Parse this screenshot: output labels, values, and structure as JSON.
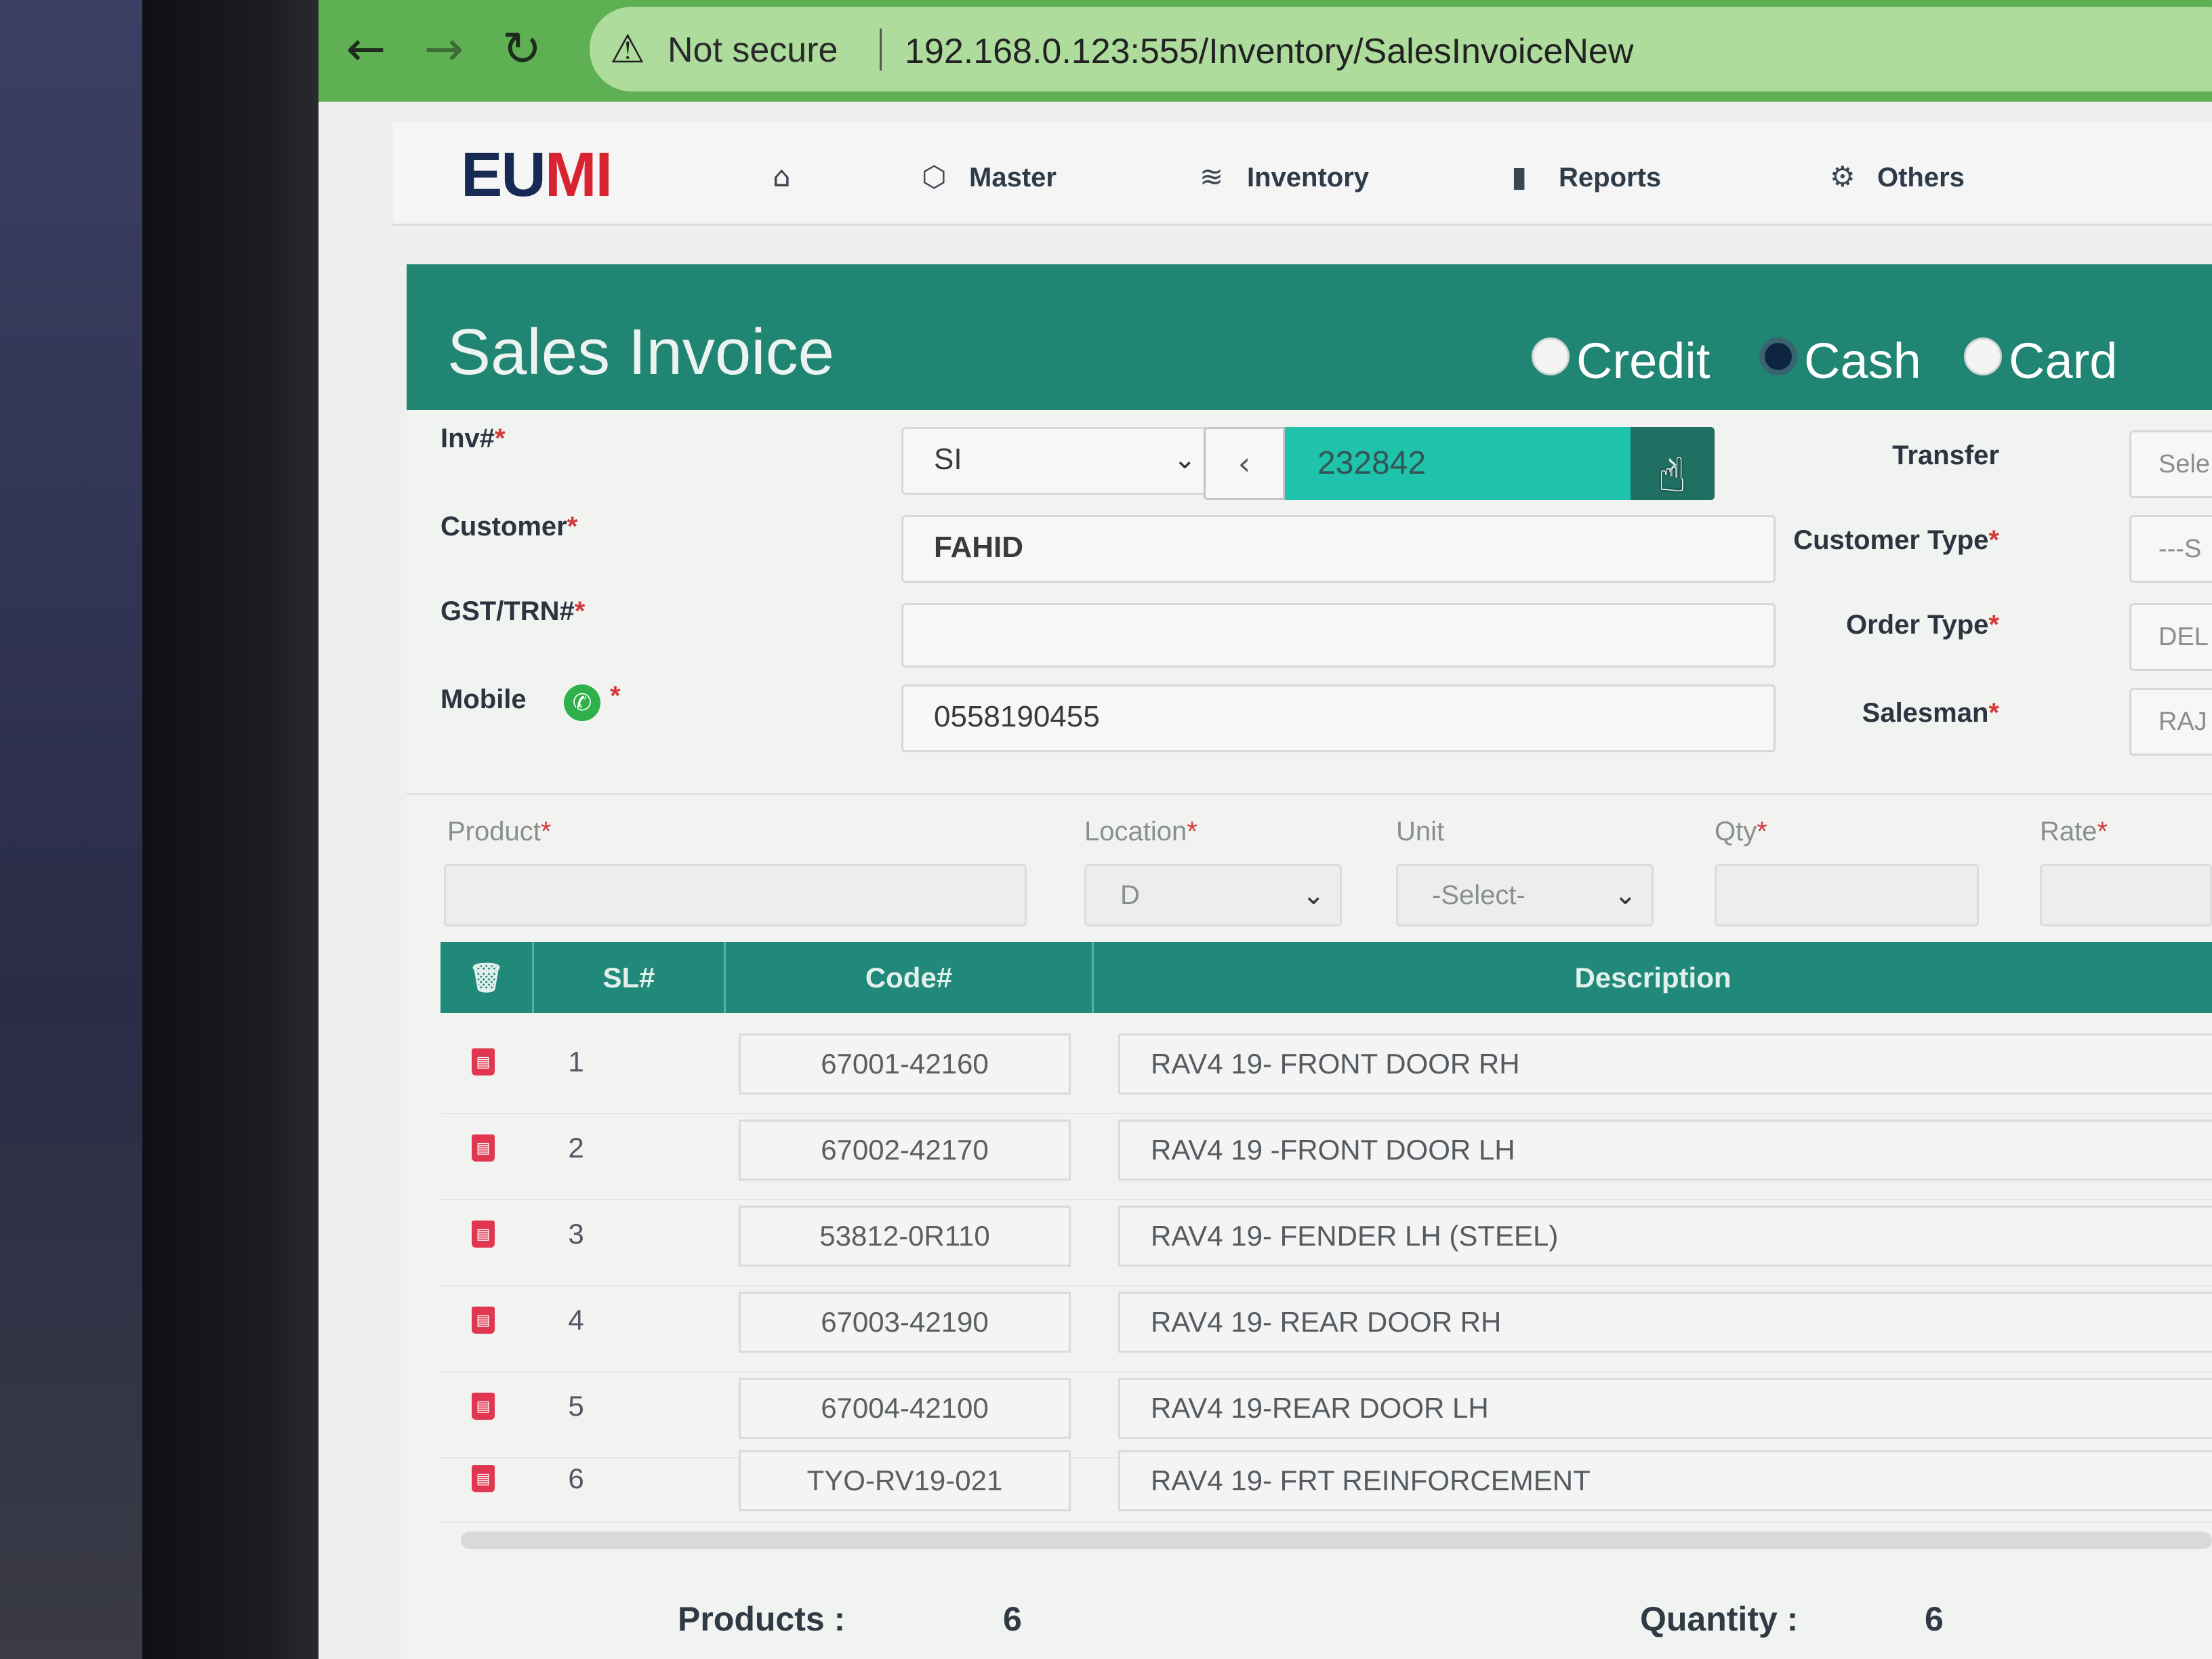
{
  "browser": {
    "security_label": "Not secure",
    "url": "192.168.0.123:555/Inventory/SalesInvoiceNew"
  },
  "nav": {
    "logo": "EUMI",
    "items": [
      {
        "label": "Master",
        "icon": "cube-icon"
      },
      {
        "label": "Inventory",
        "icon": "layers-icon"
      },
      {
        "label": "Reports",
        "icon": "bar-chart-icon"
      },
      {
        "label": "Others",
        "icon": "settings-icon"
      }
    ]
  },
  "page": {
    "title": "Sales Invoice",
    "payment_options": [
      "Credit",
      "Cash",
      "Card"
    ],
    "payment_selected": "Cash"
  },
  "form": {
    "inv_label": "Inv#",
    "inv_prefix": "SI",
    "inv_number": "232842",
    "customer_label": "Customer",
    "customer_value": "FAHID",
    "gst_label": "GST/TRN#",
    "gst_value": "",
    "mobile_label": "Mobile",
    "mobile_value": "0558190455",
    "transfer_label": "Transfer",
    "transfer_value": "Sele",
    "customer_type_label": "Customer Type",
    "customer_type_value": "---S",
    "order_type_label": "Order Type",
    "order_type_value": "DEL",
    "salesman_label": "Salesman",
    "salesman_value": "RAJ"
  },
  "product_entry": {
    "product_label": "Product",
    "location_label": "Location",
    "location_value": "D",
    "unit_label": "Unit",
    "unit_value": "-Select-",
    "qty_label": "Qty",
    "rate_label": "Rate"
  },
  "table": {
    "headers": {
      "sl": "SL#",
      "code": "Code#",
      "description": "Description"
    },
    "rows": [
      {
        "sl": "1",
        "code": "67001-42160",
        "description": "RAV4 19- FRONT DOOR RH"
      },
      {
        "sl": "2",
        "code": "67002-42170",
        "description": "RAV4 19 -FRONT DOOR LH"
      },
      {
        "sl": "3",
        "code": "53812-0R110",
        "description": "RAV4 19- FENDER LH (STEEL)"
      },
      {
        "sl": "4",
        "code": "67003-42190",
        "description": "RAV4 19- REAR DOOR RH"
      },
      {
        "sl": "5",
        "code": "67004-42100",
        "description": "RAV4 19-REAR DOOR LH"
      },
      {
        "sl": "6",
        "code": "TYO-RV19-021",
        "description": "RAV4 19- FRT REINFORCEMENT"
      }
    ]
  },
  "footer": {
    "products_label": "Products :",
    "products_value": "6",
    "quantity_label": "Quantity :",
    "quantity_value": "6"
  }
}
